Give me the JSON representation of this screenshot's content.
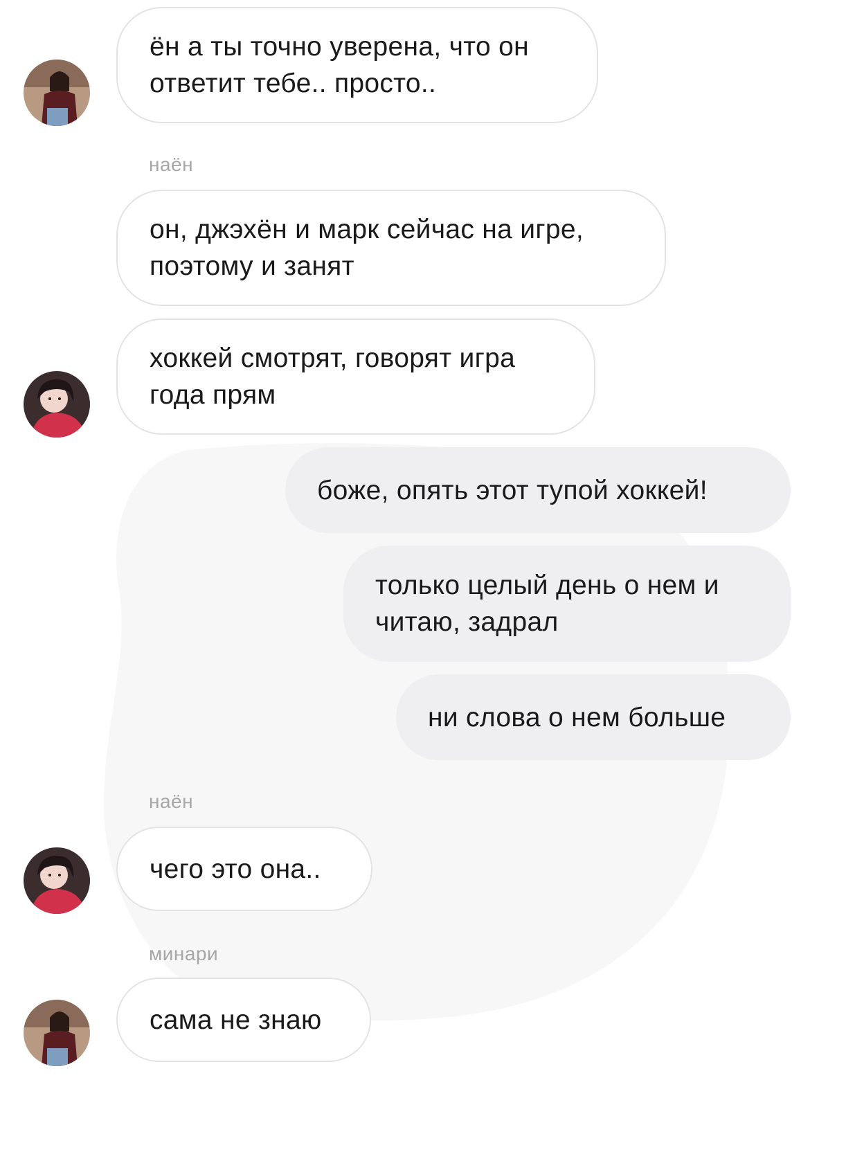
{
  "chat": {
    "messages": [
      {
        "direction": "incoming",
        "text": "ён а ты точно уверена, что он ответит тебе.. просто.."
      },
      {
        "direction": "incoming",
        "sender": "наён",
        "text": "он, джэхён и марк сейчас на игре, поэтому и занят"
      },
      {
        "direction": "incoming",
        "text": "хоккей смотрят, говорят игра года прям"
      },
      {
        "direction": "outgoing",
        "text": "боже, опять этот тупой хоккей!"
      },
      {
        "direction": "outgoing",
        "text": "только целый день о нем и читаю, задрал"
      },
      {
        "direction": "outgoing",
        "text": "ни слова о нем больше"
      },
      {
        "direction": "incoming",
        "sender": "наён",
        "text": "чего это она.."
      },
      {
        "direction": "incoming",
        "sender": "минари",
        "text": "сама не знаю"
      }
    ]
  },
  "colors": {
    "incoming_border": "#e3e3e3",
    "outgoing_bg": "#efeff1",
    "sender_label": "#a6a6a6",
    "text": "#1a1a1a"
  }
}
